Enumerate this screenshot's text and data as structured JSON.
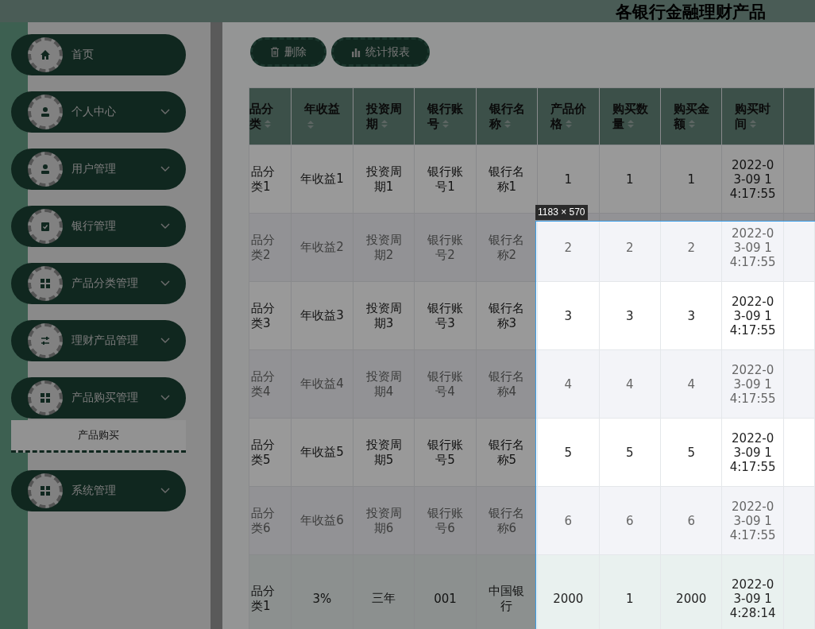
{
  "header": {
    "title": "各银行金融理财产品"
  },
  "sidebar": {
    "items": [
      {
        "label": "首页",
        "kind": "link"
      },
      {
        "label": "个人中心",
        "kind": "submenu"
      },
      {
        "label": "用户管理",
        "kind": "submenu"
      },
      {
        "label": "银行管理",
        "kind": "submenu"
      },
      {
        "label": "产品分类管理",
        "kind": "submenu"
      },
      {
        "label": "理财产品管理",
        "kind": "submenu"
      },
      {
        "label": "产品购买管理",
        "kind": "submenu",
        "children": [
          {
            "label": "产品购买",
            "selected": true
          }
        ]
      },
      {
        "label": "系统管理",
        "kind": "submenu"
      }
    ]
  },
  "toolbar": {
    "buttons": [
      {
        "label": "删除",
        "kind": "delete"
      },
      {
        "label": "统计报表",
        "kind": "chart"
      }
    ]
  },
  "table": {
    "columns": [
      "品分类",
      "年收益",
      "投资周期",
      "银行账号",
      "银行名称",
      "产品价格",
      "购买数量",
      "购买金额",
      "购买时间"
    ],
    "rows": [
      [
        "品分类1",
        "年收益1",
        "投资周期1",
        "银行账号1",
        "银行名称1",
        "1",
        "1",
        "1",
        "2022-03-09 14:17:55"
      ],
      [
        "品分类2",
        "年收益2",
        "投资周期2",
        "银行账号2",
        "银行名称2",
        "2",
        "2",
        "2",
        "2022-03-09 14:17:55"
      ],
      [
        "品分类3",
        "年收益3",
        "投资周期3",
        "银行账号3",
        "银行名称3",
        "3",
        "3",
        "3",
        "2022-03-09 14:17:55"
      ],
      [
        "品分类4",
        "年收益4",
        "投资周期4",
        "银行账号4",
        "银行名称4",
        "4",
        "4",
        "4",
        "2022-03-09 14:17:55"
      ],
      [
        "品分类5",
        "年收益5",
        "投资周期5",
        "银行账号5",
        "银行名称5",
        "5",
        "5",
        "5",
        "2022-03-09 14:17:55"
      ],
      [
        "品分类6",
        "年收益6",
        "投资周期6",
        "银行账号6",
        "银行名称6",
        "6",
        "6",
        "6",
        "2022-03-09 14:17:55"
      ],
      [
        "品分类1",
        "3%",
        "三年",
        "001",
        "中国银行",
        "2000",
        "1",
        "2000",
        "2022-03-09 14:28:14"
      ]
    ]
  },
  "inspector": {
    "size_label": "1183 × 570"
  }
}
